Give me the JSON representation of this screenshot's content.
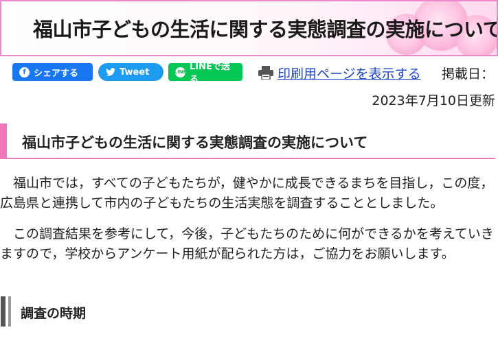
{
  "page": {
    "title": "福山市子どもの生活に関する実態調査の実施について"
  },
  "share": {
    "facebook_label": "シェアする",
    "tweet_label": "Tweet",
    "line_label": "LINEで送る",
    "line_icon_text": "LINE"
  },
  "toolbar": {
    "print_label": "印刷用ページを表示する",
    "posted_label": "掲載日：",
    "updated": "2023年7月10日更新"
  },
  "content": {
    "heading": "福山市子どもの生活に関する実態調査の実施について",
    "paragraph1": "福山市では，すべての子どもたちが，健やかに成長できるまちを目指し，この度，広島県と連携して市内の子どもたちの生活実態を調査することとしました。",
    "paragraph2": "この調査結果を参考にして，今後，子どもたちのために何ができるかを考えていきますので，学校からアンケート用紙が配られた方は，ご協力をお願いします。",
    "subheading": "調査の時期"
  },
  "colors": {
    "accent_pink": "#ee77bb",
    "link_blue": "#1a44c8",
    "facebook": "#1877f2",
    "twitter": "#1d9bf0",
    "line": "#06c755"
  },
  "icons": [
    "facebook-icon",
    "twitter-bird-icon",
    "line-icon",
    "printer-icon"
  ]
}
